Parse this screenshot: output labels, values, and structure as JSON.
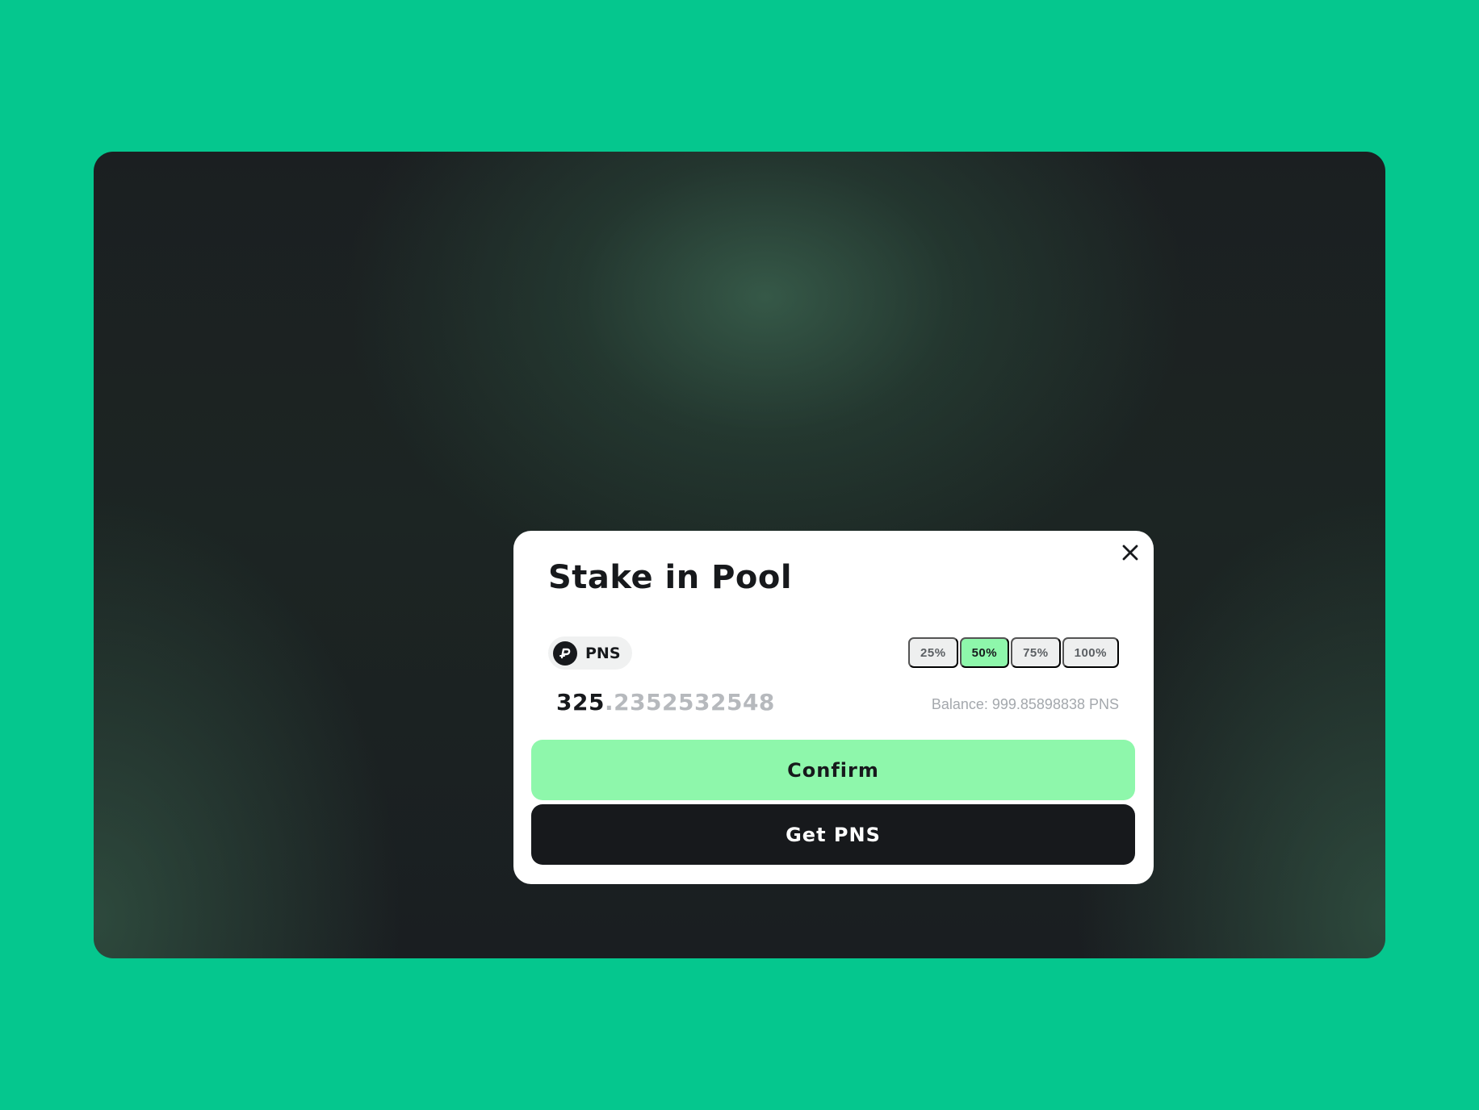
{
  "modal": {
    "title": "Stake in Pool",
    "close_icon": "close-icon",
    "token": {
      "icon": "pns-logo-icon",
      "name": "PNS"
    },
    "percent_options": [
      "25%",
      "50%",
      "75%",
      "100%"
    ],
    "selected_percent": "50%",
    "amount": {
      "integer": "325",
      "decimal": ".2352532548"
    },
    "balance": "Balance: 999.85898838 PNS",
    "confirm_label": "Confirm",
    "get_label": "Get PNS"
  },
  "colors": {
    "page_background": "#05c78e",
    "accent": "#8ef7ab",
    "dark": "#17191c"
  }
}
